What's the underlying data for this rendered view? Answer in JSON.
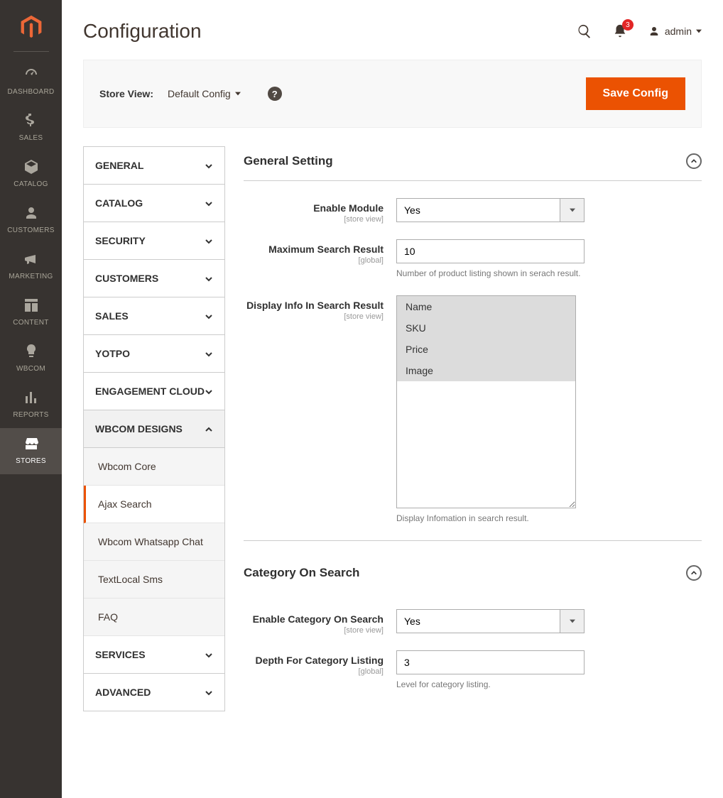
{
  "header": {
    "title": "Configuration",
    "notifications": "3",
    "user": "admin"
  },
  "toolbar": {
    "store_view_label": "Store View:",
    "store_view_value": "Default Config",
    "save_label": "Save Config"
  },
  "sidebar": {
    "items": [
      {
        "label": "DASHBOARD"
      },
      {
        "label": "SALES"
      },
      {
        "label": "CATALOG"
      },
      {
        "label": "CUSTOMERS"
      },
      {
        "label": "MARKETING"
      },
      {
        "label": "CONTENT"
      },
      {
        "label": "WBCOM"
      },
      {
        "label": "REPORTS"
      },
      {
        "label": "STORES"
      }
    ]
  },
  "config_nav": {
    "items": [
      {
        "label": "GENERAL"
      },
      {
        "label": "CATALOG"
      },
      {
        "label": "SECURITY"
      },
      {
        "label": "CUSTOMERS"
      },
      {
        "label": "SALES"
      },
      {
        "label": "YOTPO"
      },
      {
        "label": "ENGAGEMENT CLOUD"
      },
      {
        "label": "WBCOM DESIGNS"
      },
      {
        "label": "SERVICES"
      },
      {
        "label": "ADVANCED"
      }
    ],
    "wbcom_sub": [
      {
        "label": "Wbcom Core"
      },
      {
        "label": "Ajax Search"
      },
      {
        "label": "Wbcom Whatsapp Chat"
      },
      {
        "label": "TextLocal Sms"
      },
      {
        "label": "FAQ"
      }
    ]
  },
  "sections": {
    "general": {
      "title": "General Setting",
      "enable_module": {
        "label": "Enable Module",
        "scope": "[store view]",
        "value": "Yes"
      },
      "max_search": {
        "label": "Maximum Search Result",
        "scope": "[global]",
        "value": "10",
        "hint": "Number of product listing shown in serach result."
      },
      "display_info": {
        "label": "Display Info In Search Result",
        "scope": "[store view]",
        "options": [
          "Name",
          "SKU",
          "Price",
          "Image"
        ],
        "hint": "Display Infomation in search result."
      }
    },
    "category": {
      "title": "Category On Search",
      "enable": {
        "label": "Enable Category On Search",
        "scope": "[store view]",
        "value": "Yes"
      },
      "depth": {
        "label": "Depth For Category Listing",
        "scope": "[global]",
        "value": "3",
        "hint": "Level for category listing."
      }
    }
  }
}
